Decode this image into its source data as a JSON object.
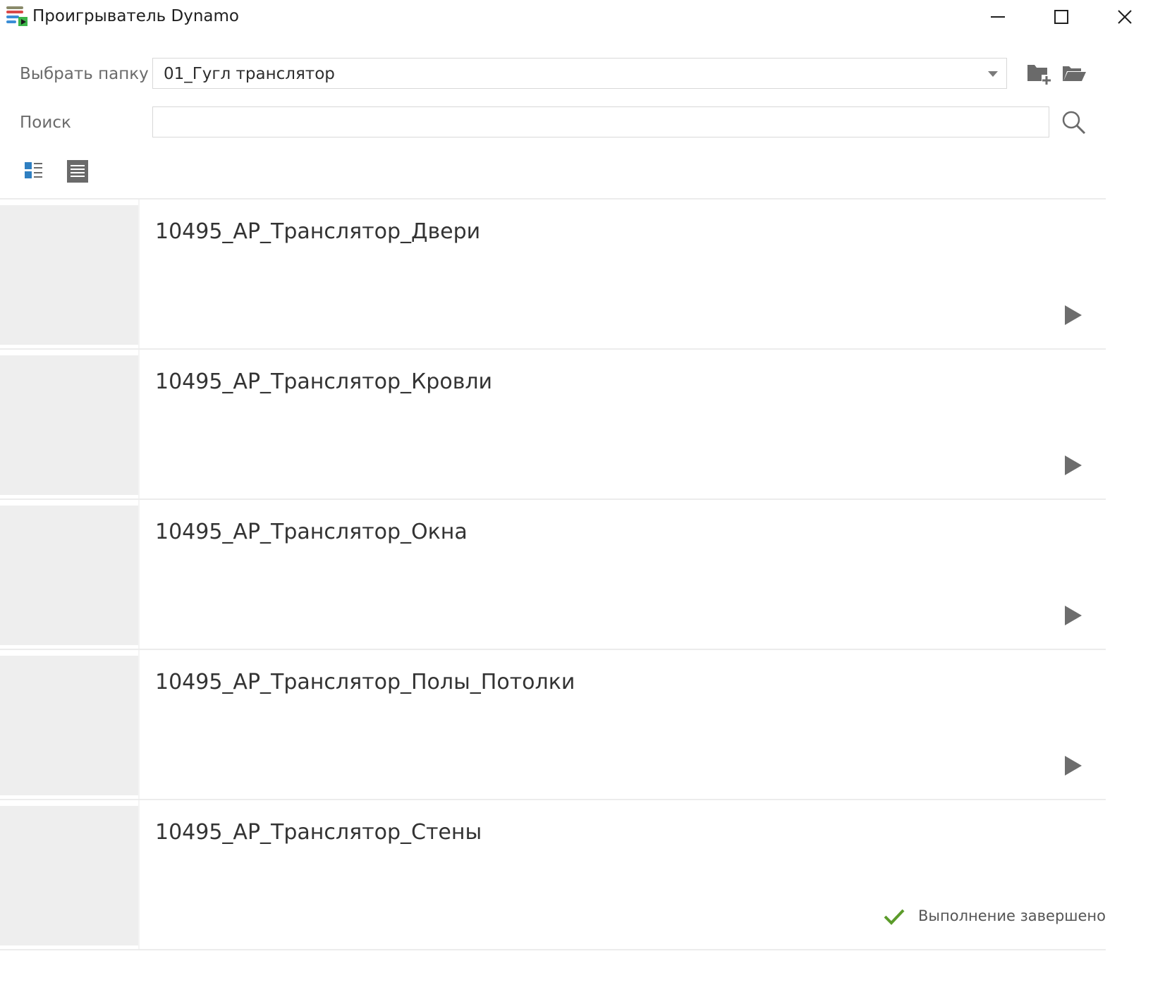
{
  "window": {
    "title": "Проигрыватель Dynamo",
    "icon": "dynamo-player-icon"
  },
  "controls": {
    "minimize": "minimize-icon",
    "maximize": "maximize-icon",
    "close": "close-icon"
  },
  "folder": {
    "label": "Выбрать папку",
    "selected": "01_Гугл транслятор"
  },
  "search": {
    "label": "Поиск",
    "value": "",
    "placeholder": ""
  },
  "view_modes": [
    "thumbnail-view-icon",
    "list-view-icon"
  ],
  "scripts": [
    {
      "name": "10495_АР_Транслятор_Двери",
      "action": "play-icon"
    },
    {
      "name": "10495_АР_Транслятор_Кровли",
      "action": "play-icon"
    },
    {
      "name": "10495_АР_Транслятор_Окна",
      "action": "play-icon"
    },
    {
      "name": "10495_АР_Транслятор_Полы_Потолки",
      "action": "play-icon"
    },
    {
      "name": "10495_АР_Транслятор_Стены",
      "action": "checkmark-icon",
      "status": "Выполнение завершено"
    }
  ],
  "colors": {
    "success": "#5b9b2a",
    "play": "#6d6d6d",
    "accent_blue": "#2f7fc1"
  }
}
